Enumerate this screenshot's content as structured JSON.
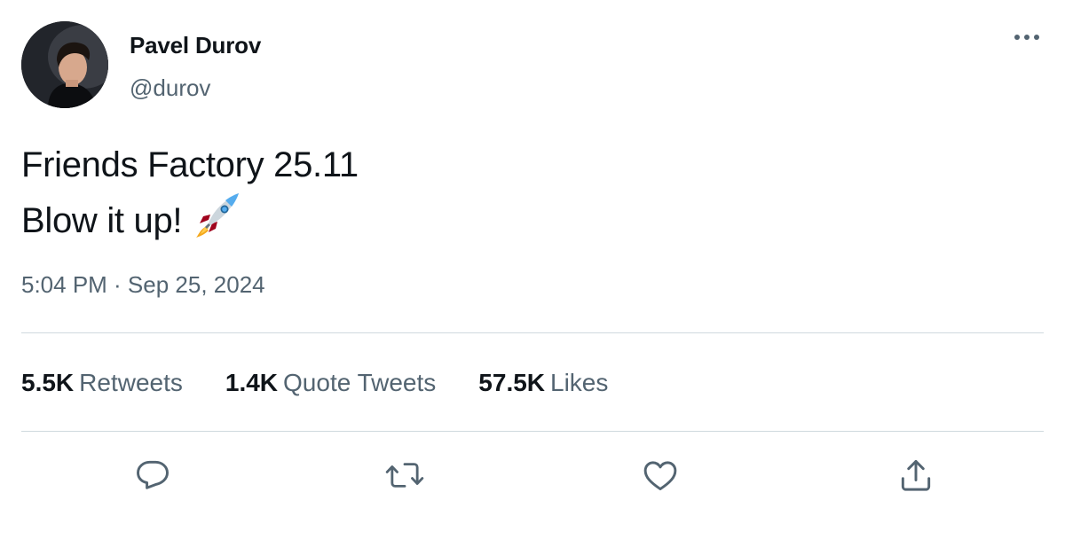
{
  "author": {
    "display_name": "Pavel Durov",
    "handle": "@durov"
  },
  "tweet": {
    "lines": [
      "Friends Factory 25.11",
      "Blow it up!"
    ],
    "emoji": "rocket-icon",
    "timestamp": "5:04 PM · Sep 25, 2024"
  },
  "stats": [
    {
      "value": "5.5K",
      "label": "Retweets"
    },
    {
      "value": "1.4K",
      "label": "Quote Tweets"
    },
    {
      "value": "57.5K",
      "label": "Likes"
    }
  ],
  "actions": [
    "reply-icon",
    "retweet-icon",
    "like-icon",
    "share-icon"
  ],
  "colors": {
    "text_primary": "#0f1419",
    "text_secondary": "#536471",
    "divider": "#cfd9de",
    "icon": "#536471"
  }
}
